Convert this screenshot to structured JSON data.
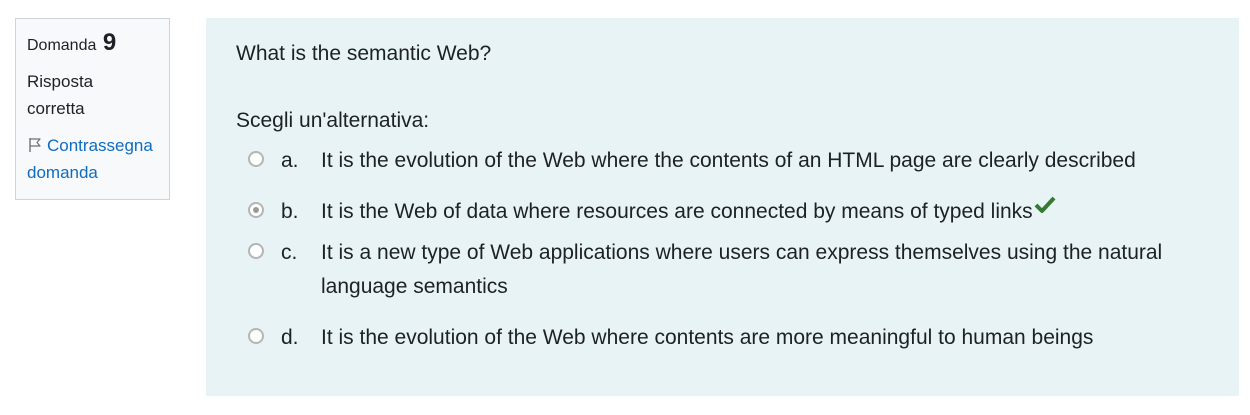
{
  "info": {
    "question_label": "Domanda",
    "question_number": "9",
    "state": "Risposta corretta",
    "flag_label": "Contrassegna domanda"
  },
  "question": {
    "text": "What is the semantic Web?",
    "prompt": "Scegli un'alternativa:",
    "answers": [
      {
        "letter": "a.",
        "text": "It is the evolution of the Web where the contents of an HTML page are clearly described",
        "selected": false
      },
      {
        "letter": "b.",
        "text": "It is the Web of data where resources are connected by means of typed links",
        "selected": true,
        "correct": true
      },
      {
        "letter": "c.",
        "text": "It is a new type of Web applications where users can express themselves using the natural language semantics",
        "selected": false
      },
      {
        "letter": "d.",
        "text": "It is the evolution of the Web where contents are more meaningful to human beings",
        "selected": false
      }
    ]
  },
  "colors": {
    "link": "#0f6cbf",
    "correct_tick": "#357a32",
    "content_bg": "#e7f3f5",
    "info_bg": "#f8f9fa"
  },
  "icons": {
    "flag": "flag-icon",
    "correct": "check-icon"
  }
}
